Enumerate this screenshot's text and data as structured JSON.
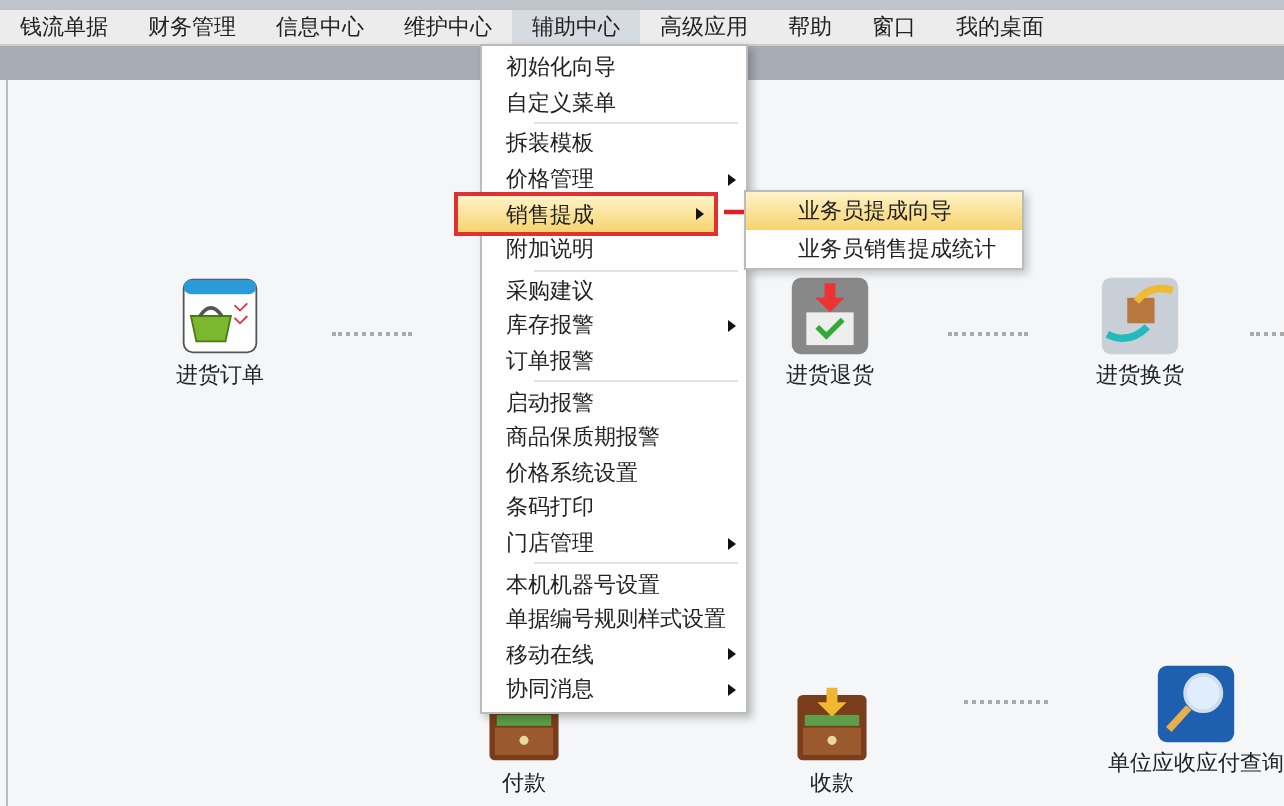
{
  "menubar": [
    {
      "label": "钱流单据",
      "selected": false
    },
    {
      "label": "财务管理",
      "selected": false
    },
    {
      "label": "信息中心",
      "selected": false
    },
    {
      "label": "维护中心",
      "selected": false
    },
    {
      "label": "辅助中心",
      "selected": true
    },
    {
      "label": "高级应用",
      "selected": false
    },
    {
      "label": "帮助",
      "selected": false
    },
    {
      "label": "窗口",
      "selected": false
    },
    {
      "label": "我的桌面",
      "selected": false
    }
  ],
  "dropdown": {
    "groups": [
      [
        {
          "label": "初始化向导",
          "submenu": false,
          "selected": false
        },
        {
          "label": "自定义菜单",
          "submenu": false,
          "selected": false
        }
      ],
      [
        {
          "label": "拆装模板",
          "submenu": false,
          "selected": false
        },
        {
          "label": "价格管理",
          "submenu": true,
          "selected": false
        },
        {
          "label": "销售提成",
          "submenu": true,
          "selected": true
        },
        {
          "label": "附加说明",
          "submenu": false,
          "selected": false
        }
      ],
      [
        {
          "label": "采购建议",
          "submenu": false,
          "selected": false
        },
        {
          "label": "库存报警",
          "submenu": true,
          "selected": false
        },
        {
          "label": "订单报警",
          "submenu": false,
          "selected": false
        }
      ],
      [
        {
          "label": "启动报警",
          "submenu": false,
          "selected": false
        },
        {
          "label": "商品保质期报警",
          "submenu": false,
          "selected": false
        },
        {
          "label": "价格系统设置",
          "submenu": false,
          "selected": false
        },
        {
          "label": "条码打印",
          "submenu": false,
          "selected": false
        },
        {
          "label": "门店管理",
          "submenu": true,
          "selected": false
        }
      ],
      [
        {
          "label": "本机机器号设置",
          "submenu": false,
          "selected": false
        },
        {
          "label": "单据编号规则样式设置",
          "submenu": false,
          "selected": false
        },
        {
          "label": "移动在线",
          "submenu": true,
          "selected": false
        },
        {
          "label": "协同消息",
          "submenu": true,
          "selected": false
        }
      ]
    ]
  },
  "submenu": [
    {
      "label": "业务员提成向导",
      "selected": true
    },
    {
      "label": "业务员销售提成统计",
      "selected": false
    }
  ],
  "nodes": [
    {
      "label": "进货订单",
      "kind": "order"
    },
    {
      "label": "进货退货",
      "kind": "return"
    },
    {
      "label": "进货换货",
      "kind": "exchange"
    },
    {
      "label": "付款",
      "kind": "drawer"
    },
    {
      "label": "收款",
      "kind": "drawer-in"
    },
    {
      "label": "单位应收应付查询",
      "kind": "search"
    }
  ]
}
